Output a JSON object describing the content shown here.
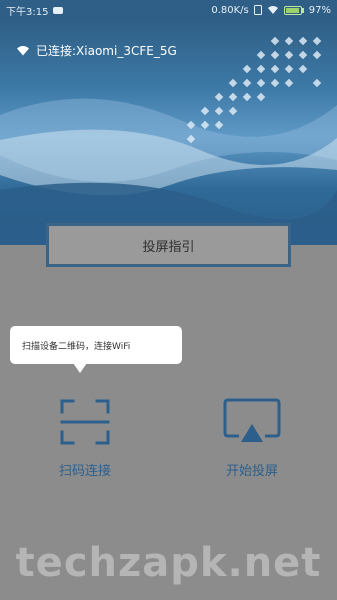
{
  "status_bar": {
    "time": "下午3:15",
    "network_speed": "0.80K/s",
    "battery_level": "97%",
    "icons": [
      "chat-icon",
      "sim-icon",
      "wifi-signal-icon",
      "battery-icon"
    ]
  },
  "banner": {
    "wifi_status": "已连接:Xiaomi_3CFE_5G",
    "wifi_icon": "wifi-icon"
  },
  "guide_button": {
    "label": "投屏指引"
  },
  "tooltip": {
    "text": "扫描设备二维码，连接WiFi"
  },
  "actions": [
    {
      "label": "扫码连接",
      "icon": "scan-icon"
    },
    {
      "label": "开始投屏",
      "icon": "screen-cast-icon"
    }
  ],
  "watermark": {
    "text": "techzapk.net"
  },
  "colors": {
    "primary": "#2d5f8c",
    "banner_dark": "#2f5f86",
    "overlay_gray": "#8c8c8c",
    "battery_green": "#9bd36a"
  }
}
